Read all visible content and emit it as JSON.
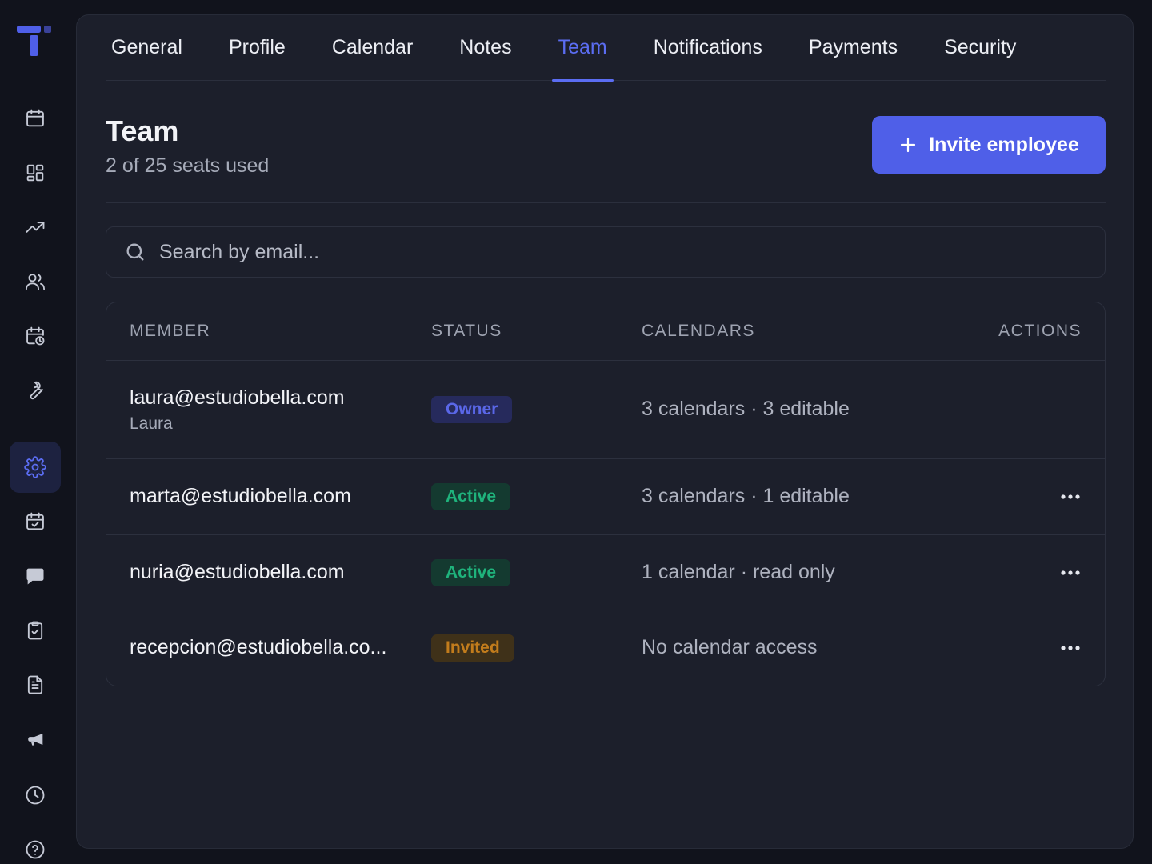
{
  "sidebar": {
    "items": [
      {
        "icon": "calendar-icon"
      },
      {
        "icon": "dashboard-grid-icon"
      },
      {
        "icon": "trending-up-icon"
      },
      {
        "icon": "users-icon"
      },
      {
        "icon": "calendar-clock-icon"
      },
      {
        "icon": "wrench-icon"
      },
      {
        "icon": "gear-icon",
        "active": true
      },
      {
        "icon": "calendar-check-icon"
      },
      {
        "icon": "chat-bubble-icon"
      },
      {
        "icon": "clipboard-check-icon"
      },
      {
        "icon": "document-icon"
      },
      {
        "icon": "megaphone-icon"
      },
      {
        "icon": "clock-icon"
      },
      {
        "icon": "help-icon"
      }
    ]
  },
  "tabs": [
    {
      "label": "General"
    },
    {
      "label": "Profile"
    },
    {
      "label": "Calendar"
    },
    {
      "label": "Notes"
    },
    {
      "label": "Team",
      "active": true
    },
    {
      "label": "Notifications"
    },
    {
      "label": "Payments"
    },
    {
      "label": "Security"
    }
  ],
  "header": {
    "title": "Team",
    "subtitle": "2 of 25 seats used",
    "invite_label": "Invite employee"
  },
  "search": {
    "placeholder": "Search by email..."
  },
  "table": {
    "columns": {
      "member": "MEMBER",
      "status": "STATUS",
      "calendars": "CALENDARS",
      "actions": "ACTIONS"
    },
    "rows": [
      {
        "email": "laura@estudiobella.com",
        "name": "Laura",
        "status": "Owner",
        "calendars": "3 calendars · 3 editable"
      },
      {
        "email": "marta@estudiobella.com",
        "status": "Active",
        "calendars": "3 calendars · 1 editable"
      },
      {
        "email": "nuria@estudiobella.com",
        "status": "Active",
        "calendars": "1 calendar · read only"
      },
      {
        "email": "recepcion@estudiobella.co...",
        "status": "Invited",
        "calendars": "No calendar access"
      }
    ]
  },
  "colors": {
    "accent": "#5b6df2",
    "button": "#4f5fe8",
    "owner": "#5a67e8",
    "active": "#1fb37c",
    "invited": "#c27c1c"
  }
}
